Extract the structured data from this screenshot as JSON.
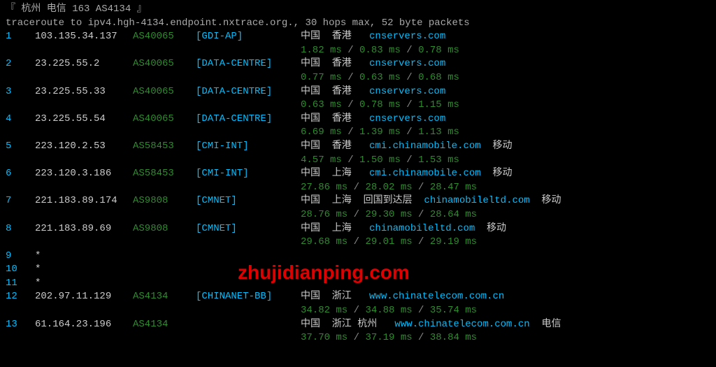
{
  "header": "『 杭州  电信  163 AS4134 』",
  "command": "traceroute to ipv4.hgh-4134.endpoint.nxtrace.org., 30 hops max, 52 byte packets",
  "watermark": "zhujidianping.com",
  "hops": [
    {
      "idx": "1",
      "ip": "103.135.34.137",
      "asn": "AS40065",
      "tag": "[GDI-AP]",
      "loc": "中国  香港   ",
      "domain": "cnservers.com",
      "suffix": "",
      "t1": "1.82 ms",
      "t2": "0.83 ms",
      "t3": "0.78 ms"
    },
    {
      "idx": "2",
      "ip": "23.225.55.2",
      "asn": "AS40065",
      "tag": "[DATA-CENTRE]",
      "loc": "中国  香港   ",
      "domain": "cnservers.com",
      "suffix": "",
      "t1": "0.77 ms",
      "t2": "0.63 ms",
      "t3": "0.68 ms"
    },
    {
      "idx": "3",
      "ip": "23.225.55.33",
      "asn": "AS40065",
      "tag": "[DATA-CENTRE]",
      "loc": "中国  香港   ",
      "domain": "cnservers.com",
      "suffix": "",
      "t1": "0.63 ms",
      "t2": "0.78 ms",
      "t3": "1.15 ms"
    },
    {
      "idx": "4",
      "ip": "23.225.55.54",
      "asn": "AS40065",
      "tag": "[DATA-CENTRE]",
      "loc": "中国  香港   ",
      "domain": "cnservers.com",
      "suffix": "",
      "t1": "6.69 ms",
      "t2": "1.39 ms",
      "t3": "1.13 ms"
    },
    {
      "idx": "5",
      "ip": "223.120.2.53",
      "asn": "AS58453",
      "tag": "[CMI-INT]",
      "loc": "中国  香港   ",
      "domain": "cmi.chinamobile.com",
      "suffix": "  移动",
      "t1": "4.57 ms",
      "t2": "1.50 ms",
      "t3": "1.53 ms"
    },
    {
      "idx": "6",
      "ip": "223.120.3.186",
      "asn": "AS58453",
      "tag": "[CMI-INT]",
      "loc": "中国  上海   ",
      "domain": "cmi.chinamobile.com",
      "suffix": "  移动",
      "t1": "27.86 ms",
      "t2": "28.02 ms",
      "t3": "28.47 ms"
    },
    {
      "idx": "7",
      "ip": "221.183.89.174",
      "asn": "AS9808",
      "tag": "[CMNET]",
      "loc": "中国  上海  回国到达层  ",
      "domain": "chinamobileltd.com",
      "suffix": "  移动",
      "t1": "28.76 ms",
      "t2": "29.30 ms",
      "t3": "28.64 ms"
    },
    {
      "idx": "8",
      "ip": "221.183.89.69",
      "asn": "AS9808",
      "tag": "[CMNET]",
      "loc": "中国  上海   ",
      "domain": "chinamobileltd.com",
      "suffix": "  移动",
      "t1": "29.68 ms",
      "t2": "29.01 ms",
      "t3": "29.19 ms"
    },
    {
      "idx": "9",
      "star": "*"
    },
    {
      "idx": "10",
      "star": "*"
    },
    {
      "idx": "11",
      "star": "*"
    },
    {
      "idx": "12",
      "ip": "202.97.11.129",
      "asn": "AS4134",
      "tag": "[CHINANET-BB]",
      "loc": "中国  浙江   ",
      "domain": "www.chinatelecom.com.cn",
      "suffix": "",
      "t1": "34.82 ms",
      "t2": "34.88 ms",
      "t3": "35.74 ms"
    },
    {
      "idx": "13",
      "ip": "61.164.23.196",
      "asn": "AS4134",
      "tag": "",
      "loc": "中国  浙江 杭州   ",
      "domain": "www.chinatelecom.com.cn",
      "suffix": "  电信",
      "t1": "37.70 ms",
      "t2": "37.19 ms",
      "t3": "38.84 ms"
    }
  ]
}
